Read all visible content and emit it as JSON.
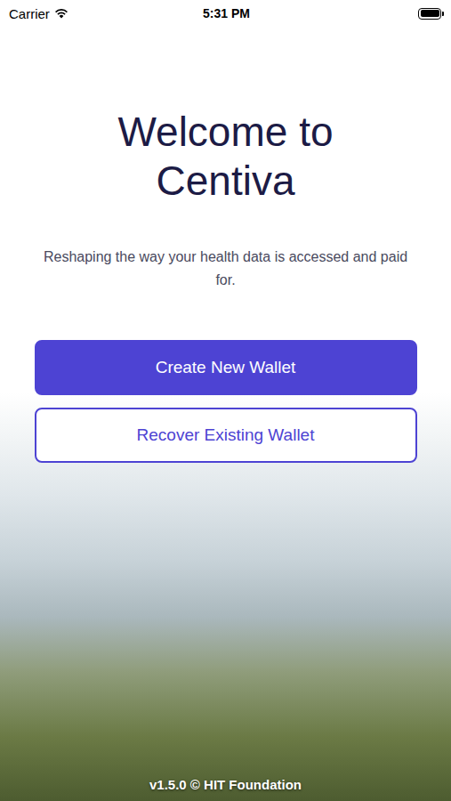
{
  "status_bar": {
    "carrier": "Carrier",
    "time": "5:31 PM",
    "wifi": true,
    "battery_level": 1.0
  },
  "title_lines": [
    "Welcome to",
    "Centiva"
  ],
  "subtitle": "Reshaping the way your health data is accessed and paid for.",
  "buttons": [
    {
      "label": "Create New Wallet",
      "kind": "primary"
    },
    {
      "label": "Recover Existing Wallet",
      "kind": "secondary"
    }
  ],
  "footer": "v1.5.0 © HIT Foundation"
}
